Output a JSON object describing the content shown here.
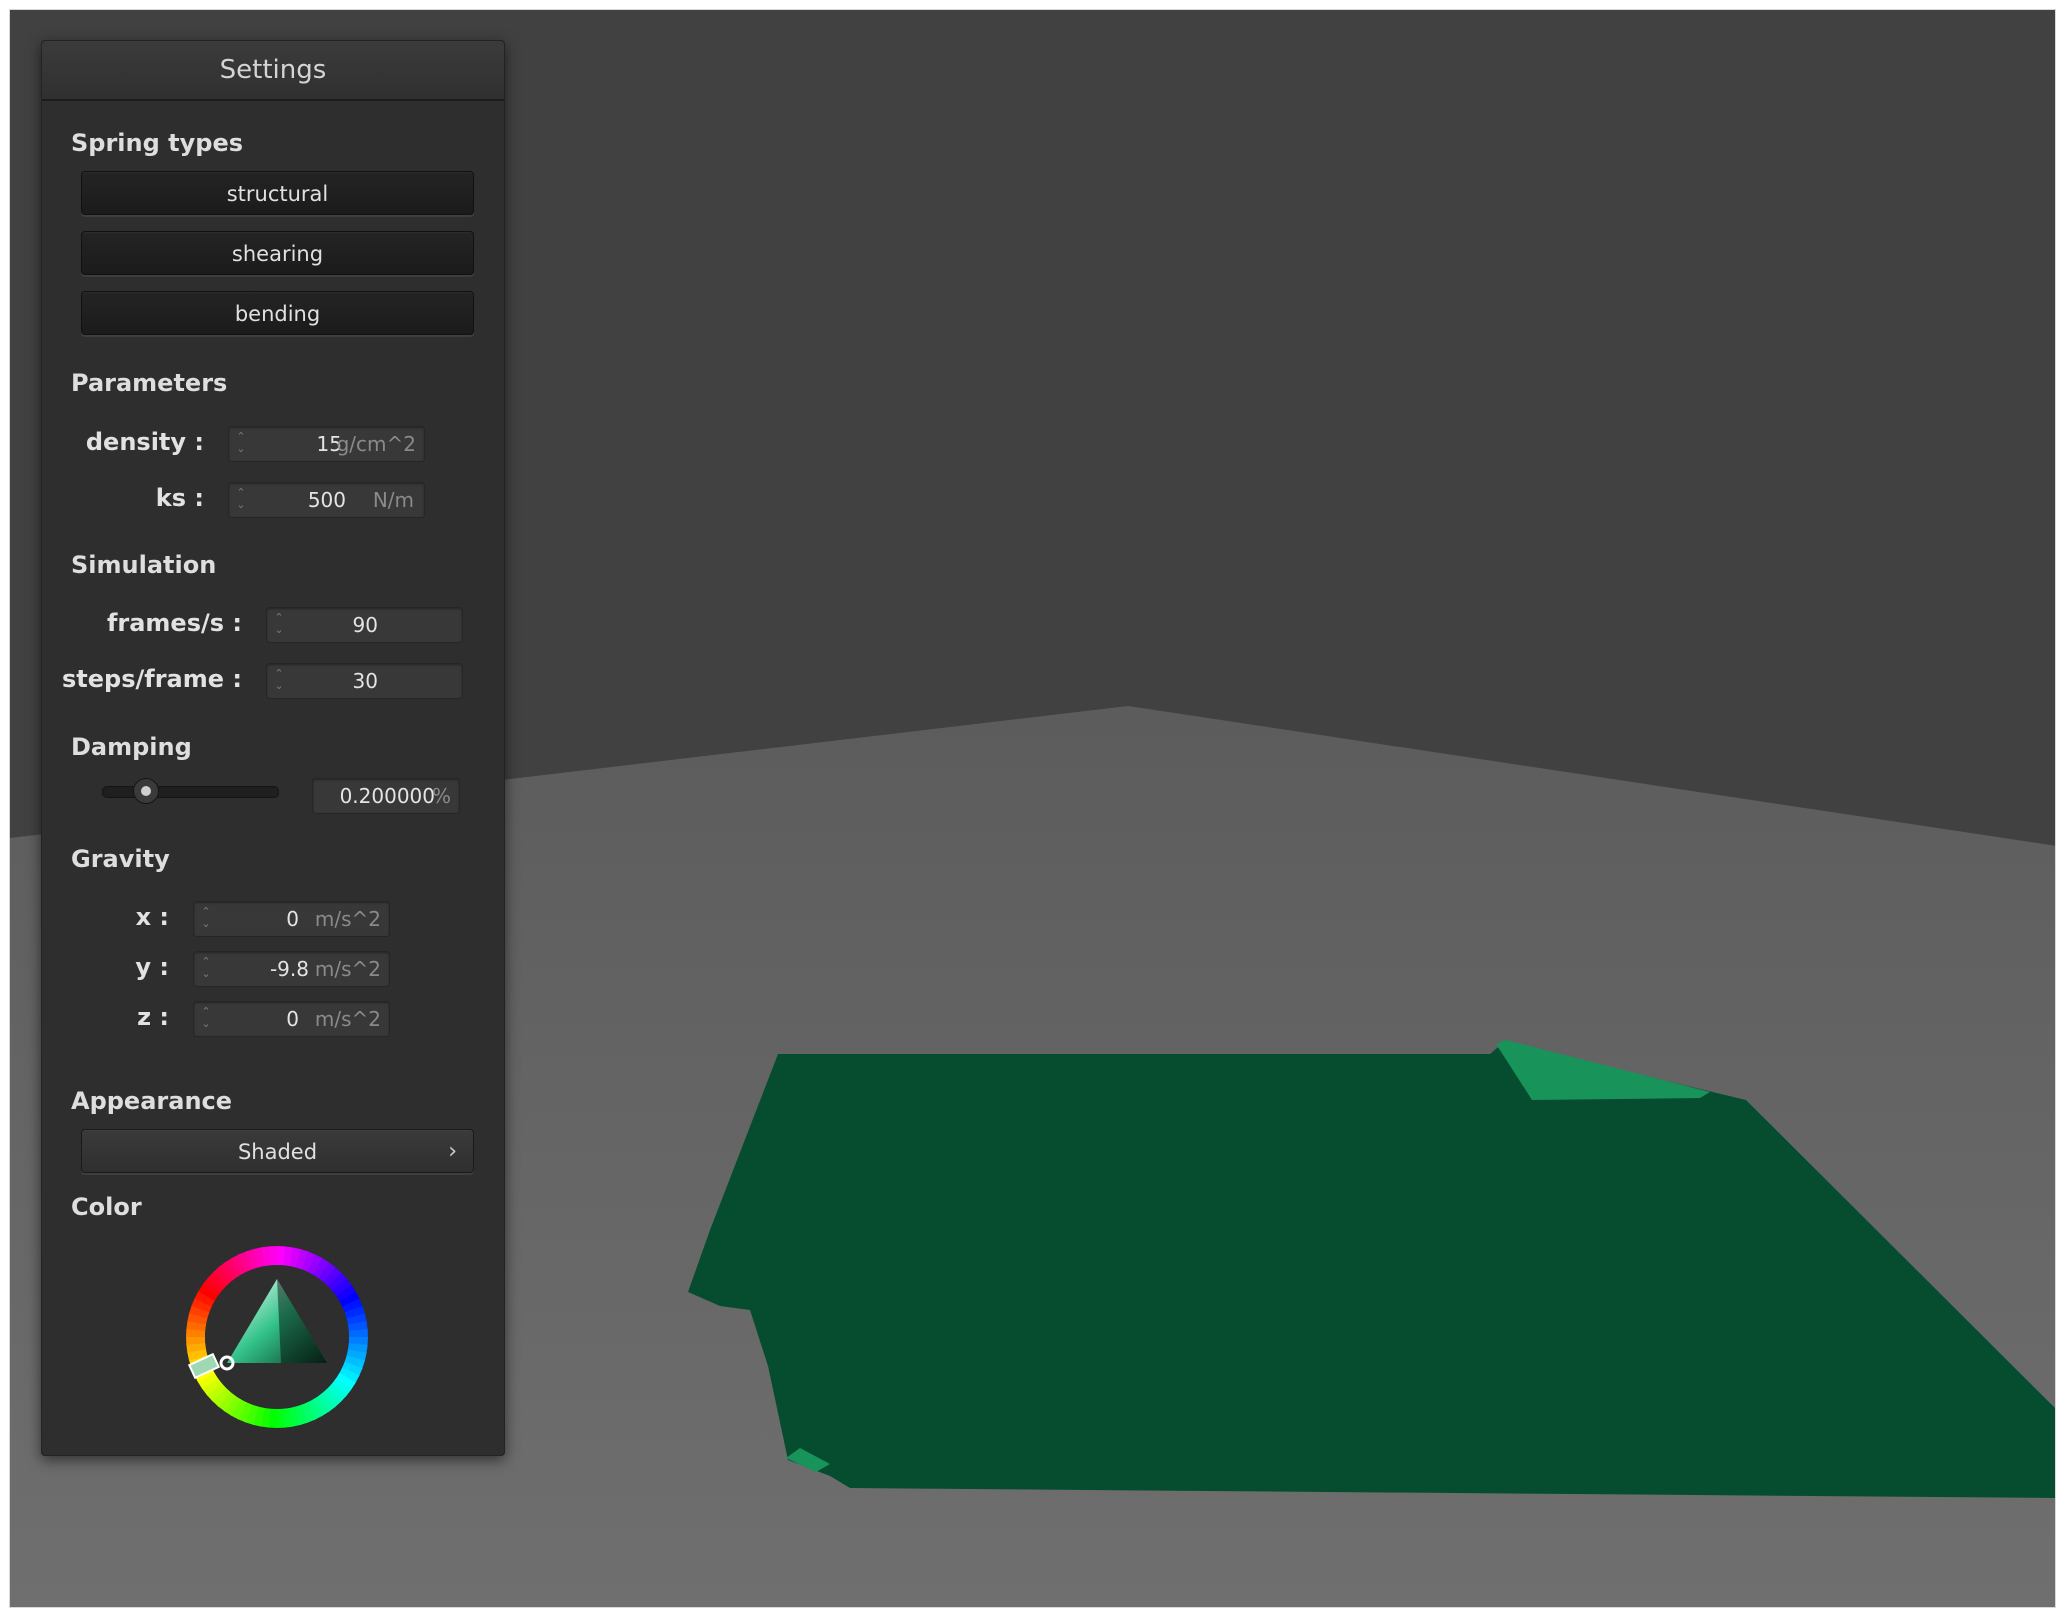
{
  "colors": {
    "background": "#414141",
    "floor": "#666666",
    "cloth": "#064d30",
    "cloth_highlight": "#18935a",
    "panel": "#2e2e2e"
  },
  "settings": {
    "title": "Settings",
    "spring_types": {
      "heading": "Spring types",
      "buttons": [
        "structural",
        "shearing",
        "bending"
      ]
    },
    "parameters": {
      "heading": "Parameters",
      "density": {
        "label": "density :",
        "value": "15",
        "unit": "g/cm^2"
      },
      "ks": {
        "label": "ks :",
        "value": "500",
        "unit": "N/m"
      }
    },
    "simulation": {
      "heading": "Simulation",
      "fps": {
        "label": "frames/s :",
        "value": "90"
      },
      "steps": {
        "label": "steps/frame :",
        "value": "30"
      }
    },
    "damping": {
      "heading": "Damping",
      "value": "0.200000",
      "unit": "%",
      "slider_fraction": 0.2
    },
    "gravity": {
      "heading": "Gravity",
      "x": {
        "label": "x :",
        "value": "0",
        "unit": "m/s^2"
      },
      "y": {
        "label": "y :",
        "value": "-9.8",
        "unit": "m/s^2"
      },
      "z": {
        "label": "z :",
        "value": "0",
        "unit": "m/s^2"
      }
    },
    "appearance": {
      "heading": "Appearance",
      "selected": "Shaded",
      "chevron_icon": "chevron-right-icon"
    },
    "color": {
      "heading": "Color",
      "selected_hue": "green",
      "widget_icon": "color-wheel-icon"
    }
  }
}
